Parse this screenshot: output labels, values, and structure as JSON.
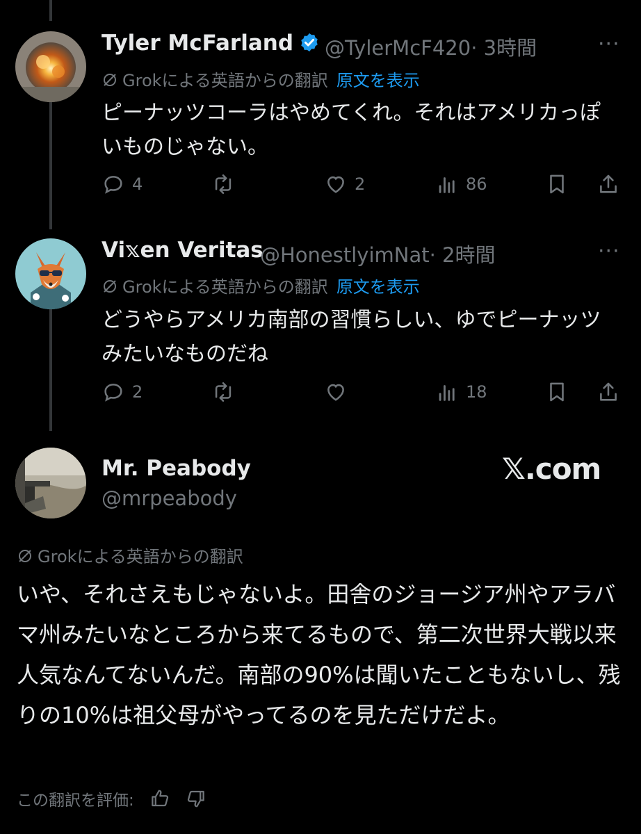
{
  "tweets": [
    {
      "display_name": "Tyler McFarland",
      "handle": "@TylerMcF420",
      "time": "· 3時間",
      "grok_label": "Grokによる英語からの翻訳",
      "show_original": "原文を表示",
      "text": "ピーナッツコーラはやめてくれ。それはアメリカっぽいものじゃない。",
      "replies": "4",
      "reposts": "",
      "likes": "2",
      "views": "86"
    },
    {
      "display_name": "Vi𝕩en Veritas",
      "handle": "@HonestlyimNat",
      "time": "· 2時間",
      "grok_label": "Grokによる英語からの翻訳",
      "show_original": "原文を表示",
      "text": "どうやらアメリカ南部の習慣らしい、ゆでピーナッツみたいなものだね",
      "replies": "2",
      "reposts": "",
      "likes": "",
      "views": "18"
    }
  ],
  "main_post": {
    "display_name": "Mr. Peabody",
    "handle": "@mrpeabody",
    "watermark": "𝕏.com",
    "grok_label": "Grokによる英語からの翻訳",
    "text": "いや、それさえもじゃないよ。田舎のジョージア州やアラバマ州みたいなところから来てるもので、第二次世界大戦以来人気なんてないんだ。南部の90%は聞いたこともないし、残りの10%は祖父母がやってるのを見ただけだよ。",
    "rate_label": "この翻訳を評価:"
  },
  "more_label": "···",
  "colors": {
    "accent": "#1d9bf0",
    "muted": "#71767b",
    "text": "#e7e9ea",
    "background": "#000000"
  }
}
